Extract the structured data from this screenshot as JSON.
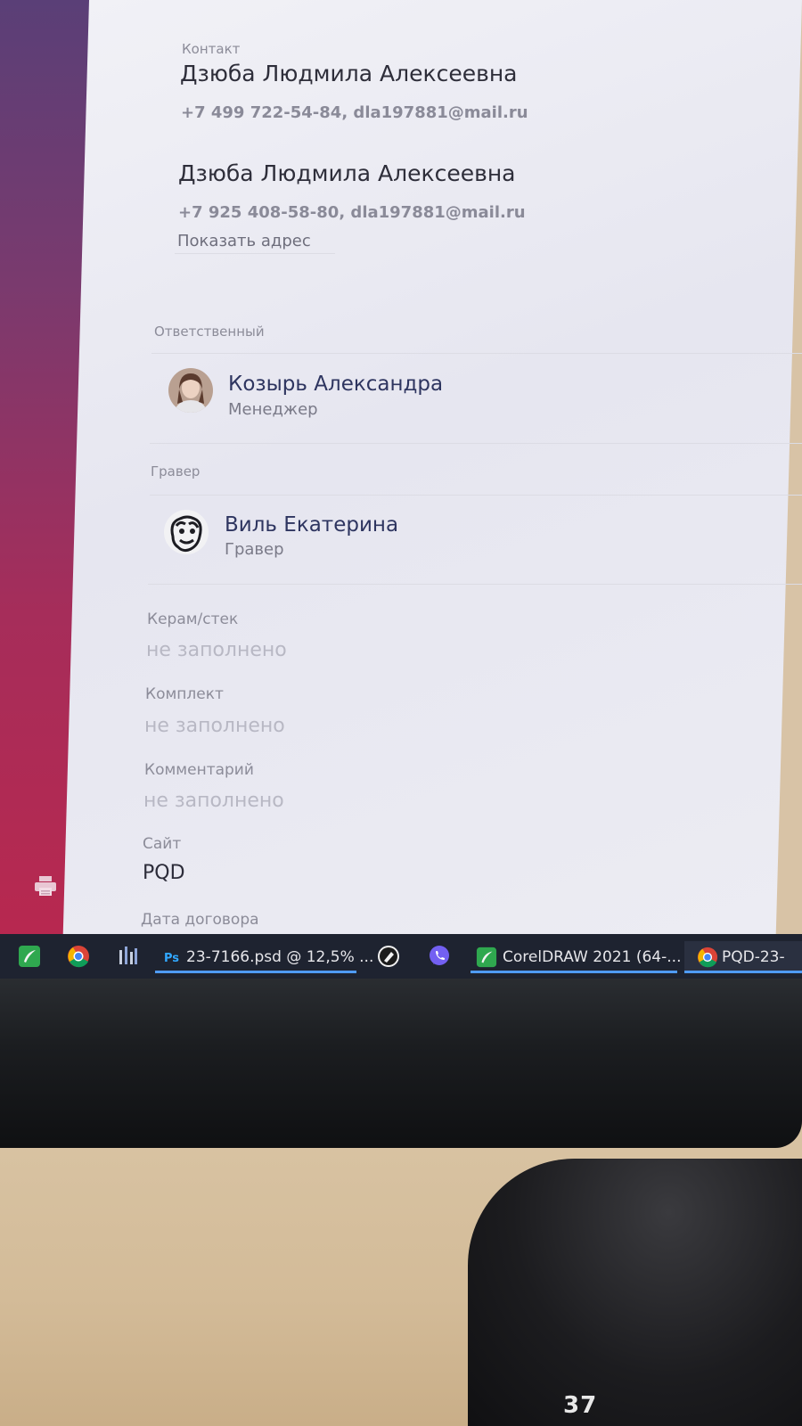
{
  "crm": {
    "contact": {
      "section_label": "Контакт",
      "entries": [
        {
          "name": "Дзюба Людмила Алексеевна",
          "details": "+7 499 722-54-84, dla197881@mail.ru"
        },
        {
          "name": "Дзюба Людмила Алексеевна",
          "details": "+7 925 408-58-80, dla197881@mail.ru"
        }
      ],
      "show_address_label": "Показать адрес"
    },
    "responsible": {
      "section_label": "Ответственный",
      "name": "Козырь Александра",
      "role": "Менеджер"
    },
    "engraver": {
      "section_label": "Гравер",
      "name": "Виль Екатерина",
      "role": "Гравер"
    },
    "fields": [
      {
        "label": "Керам/стек",
        "value": "не заполнено",
        "empty": true
      },
      {
        "label": "Комплект",
        "value": "не заполнено",
        "empty": true
      },
      {
        "label": "Комментарий",
        "value": "не заполнено",
        "empty": true
      },
      {
        "label": "Сайт",
        "value": "PQD",
        "empty": false
      }
    ],
    "contract_date_label": "Дата договора"
  },
  "taskbar": {
    "photoshop_badge": "Ps",
    "photoshop_title": "23-7166.psd @ 12,5% ...",
    "coreldraw_title": "CorelDRAW 2021 (64-...",
    "chrome_title": "PQD-23-",
    "icons": [
      "coreldraw-icon",
      "chrome-icon",
      "app-icon",
      "photoshop-icon",
      "pen-icon",
      "viber-icon"
    ]
  },
  "monitor": {
    "stand_label": "37"
  },
  "colors": {
    "taskbar_bg": "#1e2330",
    "active_underline": "#4f9bff",
    "wallpaper_top": "#5a3f77",
    "wallpaper_bottom": "#b8284f"
  }
}
